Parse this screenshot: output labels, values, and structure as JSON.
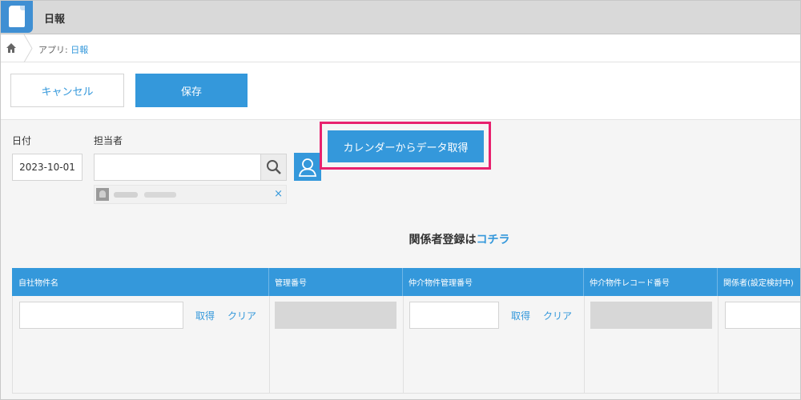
{
  "app": {
    "title": "日報",
    "icon": "document-icon"
  },
  "breadcrumb": {
    "prefix": "アプリ: ",
    "app_link": "日報"
  },
  "toolbar": {
    "cancel_label": "キャンセル",
    "save_label": "保存"
  },
  "fields": {
    "date_label": "日付",
    "date_value": "2023-10-01",
    "assignee_label": "担当者",
    "assignee_value": "",
    "chip_remove": "×"
  },
  "calendar_button": "カレンダーからデータ取得",
  "section": {
    "title": "関係者登録は",
    "link": "コチラ"
  },
  "table": {
    "headers": [
      "自社物件名",
      "管理番号",
      "仲介物件管理番号",
      "仲介物件レコード番号",
      "関係者(設定検討中)"
    ],
    "actions": {
      "get": "取得",
      "clear": "クリア"
    }
  },
  "colors": {
    "accent": "#3498db",
    "highlight": "#e8216e"
  }
}
